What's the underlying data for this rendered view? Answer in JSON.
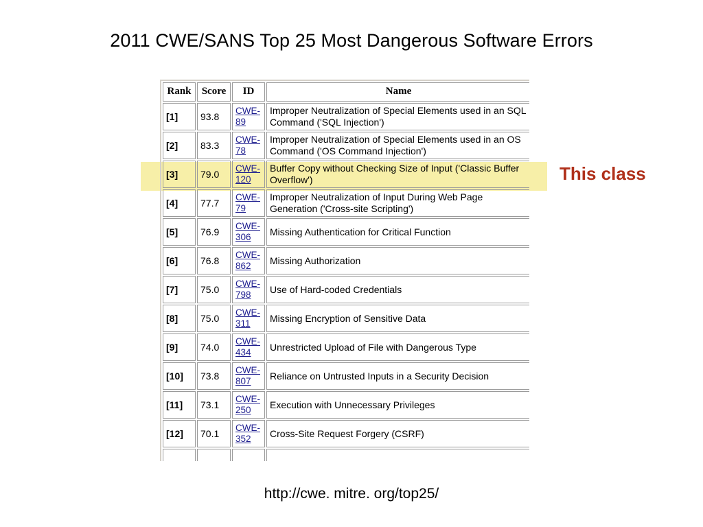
{
  "slide": {
    "title": "2011 CWE/SANS Top 25 Most Dangerous Software Errors",
    "source_url": "http://cwe. mitre. org/top25/",
    "callout": "This class",
    "callout_color": "#b0301a",
    "highlight_color": "#f7efa8",
    "link_color": "#1f1f8f"
  },
  "table": {
    "headers": {
      "rank": "Rank",
      "score": "Score",
      "id": "ID",
      "name": "Name"
    },
    "rows": [
      {
        "rank": "[1]",
        "score": "93.8",
        "id": "CWE-89",
        "name": "Improper Neutralization of Special Elements used in an SQL Command ('SQL Injection')",
        "highlighted": false
      },
      {
        "rank": "[2]",
        "score": "83.3",
        "id": "CWE-78",
        "name": "Improper Neutralization of Special Elements used in an OS Command ('OS Command Injection')",
        "highlighted": false
      },
      {
        "rank": "[3]",
        "score": "79.0",
        "id": "CWE-120",
        "name": "Buffer Copy without Checking Size of Input ('Classic Buffer Overflow')",
        "highlighted": true
      },
      {
        "rank": "[4]",
        "score": "77.7",
        "id": "CWE-79",
        "name": "Improper Neutralization of Input During Web Page Generation ('Cross-site Scripting')",
        "highlighted": false
      },
      {
        "rank": "[5]",
        "score": "76.9",
        "id": "CWE-306",
        "name": "Missing Authentication for Critical Function",
        "highlighted": false
      },
      {
        "rank": "[6]",
        "score": "76.8",
        "id": "CWE-862",
        "name": "Missing Authorization",
        "highlighted": false
      },
      {
        "rank": "[7]",
        "score": "75.0",
        "id": "CWE-798",
        "name": "Use of Hard-coded Credentials",
        "highlighted": false
      },
      {
        "rank": "[8]",
        "score": "75.0",
        "id": "CWE-311",
        "name": "Missing Encryption of Sensitive Data",
        "highlighted": false
      },
      {
        "rank": "[9]",
        "score": "74.0",
        "id": "CWE-434",
        "name": "Unrestricted Upload of File with Dangerous Type",
        "highlighted": false
      },
      {
        "rank": "[10]",
        "score": "73.8",
        "id": "CWE-807",
        "name": "Reliance on Untrusted Inputs in a Security Decision",
        "highlighted": false
      },
      {
        "rank": "[11]",
        "score": "73.1",
        "id": "CWE-250",
        "name": "Execution with Unnecessary Privileges",
        "highlighted": false
      },
      {
        "rank": "[12]",
        "score": "70.1",
        "id": "CWE-352",
        "name": "Cross-Site Request Forgery (CSRF)",
        "highlighted": false
      },
      {
        "rank": "",
        "score": "",
        "id": "",
        "name": "",
        "highlighted": false
      }
    ]
  }
}
